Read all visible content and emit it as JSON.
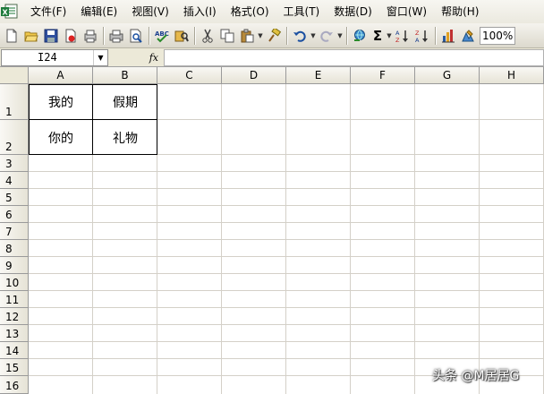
{
  "menu": {
    "items": [
      "文件(F)",
      "编辑(E)",
      "视图(V)",
      "插入(I)",
      "格式(O)",
      "工具(T)",
      "数据(D)",
      "窗口(W)",
      "帮助(H)"
    ]
  },
  "toolbar": {
    "sigma_label": "Σ",
    "zoom_value": "100%"
  },
  "formula_bar": {
    "name_box": "I24",
    "fx_label": "fx",
    "formula": ""
  },
  "sheet": {
    "columns": [
      "A",
      "B",
      "C",
      "D",
      "E",
      "F",
      "G",
      "H"
    ],
    "rows": [
      "1",
      "2",
      "3",
      "4",
      "5",
      "6",
      "7",
      "8",
      "9",
      "10",
      "11",
      "12",
      "13",
      "14",
      "15",
      "16"
    ],
    "cells": {
      "A1": "我的",
      "B1": "假期",
      "A2": "你的",
      "B2": "礼物"
    }
  },
  "watermark": "头条 @M居居G",
  "colors": {
    "excel_green": "#1d7a3a",
    "chrome_bg": "#ece9d8",
    "gridline": "#d4d0c8"
  }
}
